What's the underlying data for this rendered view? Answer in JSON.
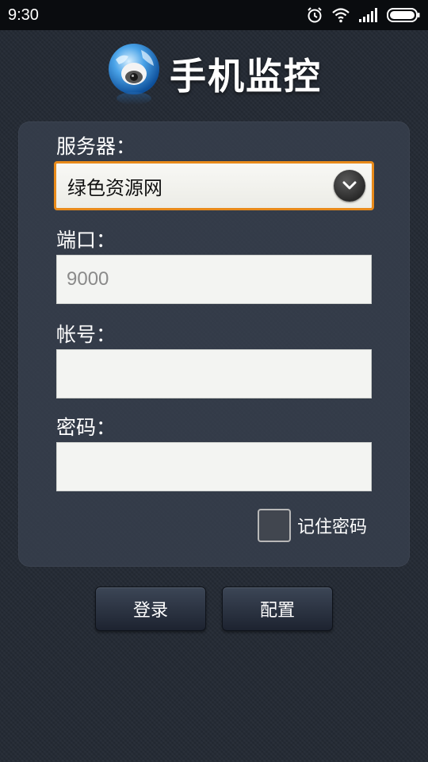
{
  "status_bar": {
    "time": "9:30",
    "icons": [
      "alarm-icon",
      "wifi-icon",
      "signal-icon",
      "battery-icon"
    ]
  },
  "header": {
    "title": "手机监控",
    "logo_icon": "globe-camera-icon"
  },
  "form": {
    "server_label": "服务器：",
    "server_value": "绿色资源网",
    "port_label": "端口：",
    "port_placeholder": "9000",
    "port_value": "",
    "account_label": "帐号：",
    "account_value": "",
    "password_label": "密码：",
    "password_value": "",
    "remember_label": "记住密码",
    "remember_checked": false
  },
  "buttons": {
    "login": "登录",
    "config": "配置"
  },
  "colors": {
    "accent": "#e88a1a",
    "background": "#252b35",
    "panel": "#3a4250"
  }
}
